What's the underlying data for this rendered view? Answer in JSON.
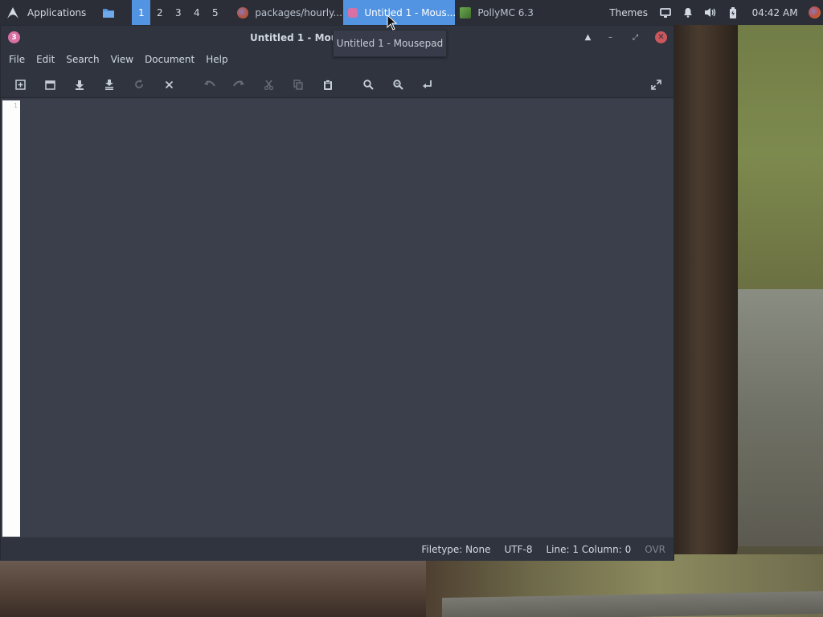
{
  "panel": {
    "applications_label": "Applications",
    "workspaces": [
      "1",
      "2",
      "3",
      "4",
      "5"
    ],
    "active_workspace": "1",
    "tasks": [
      {
        "label": "packages/hourly....",
        "icon": "firefox-icon",
        "active": false
      },
      {
        "label": "Untitled 1 - Mous...",
        "icon": "mousepad-icon",
        "active": true
      },
      {
        "label": "PollyMC 6.3",
        "icon": "pollymc-icon",
        "active": false
      }
    ],
    "themes_label": "Themes",
    "clock": "04:42 AM"
  },
  "tooltip": {
    "text": "Untitled 1 - Mousepad"
  },
  "window": {
    "title": "Untitled 1 - Mous",
    "menu": [
      "File",
      "Edit",
      "Search",
      "View",
      "Document",
      "Help"
    ],
    "gutter_line": "1",
    "status": {
      "filetype": "Filetype: None",
      "encoding": "UTF-8",
      "position": "Line: 1 Column: 0",
      "mode": "OVR"
    }
  },
  "colors": {
    "accent": "#5294e2",
    "panel_bg": "#2b2e37",
    "window_bg": "#2f343f",
    "editor_bg": "#3b3f4c",
    "close": "#cc575d"
  }
}
